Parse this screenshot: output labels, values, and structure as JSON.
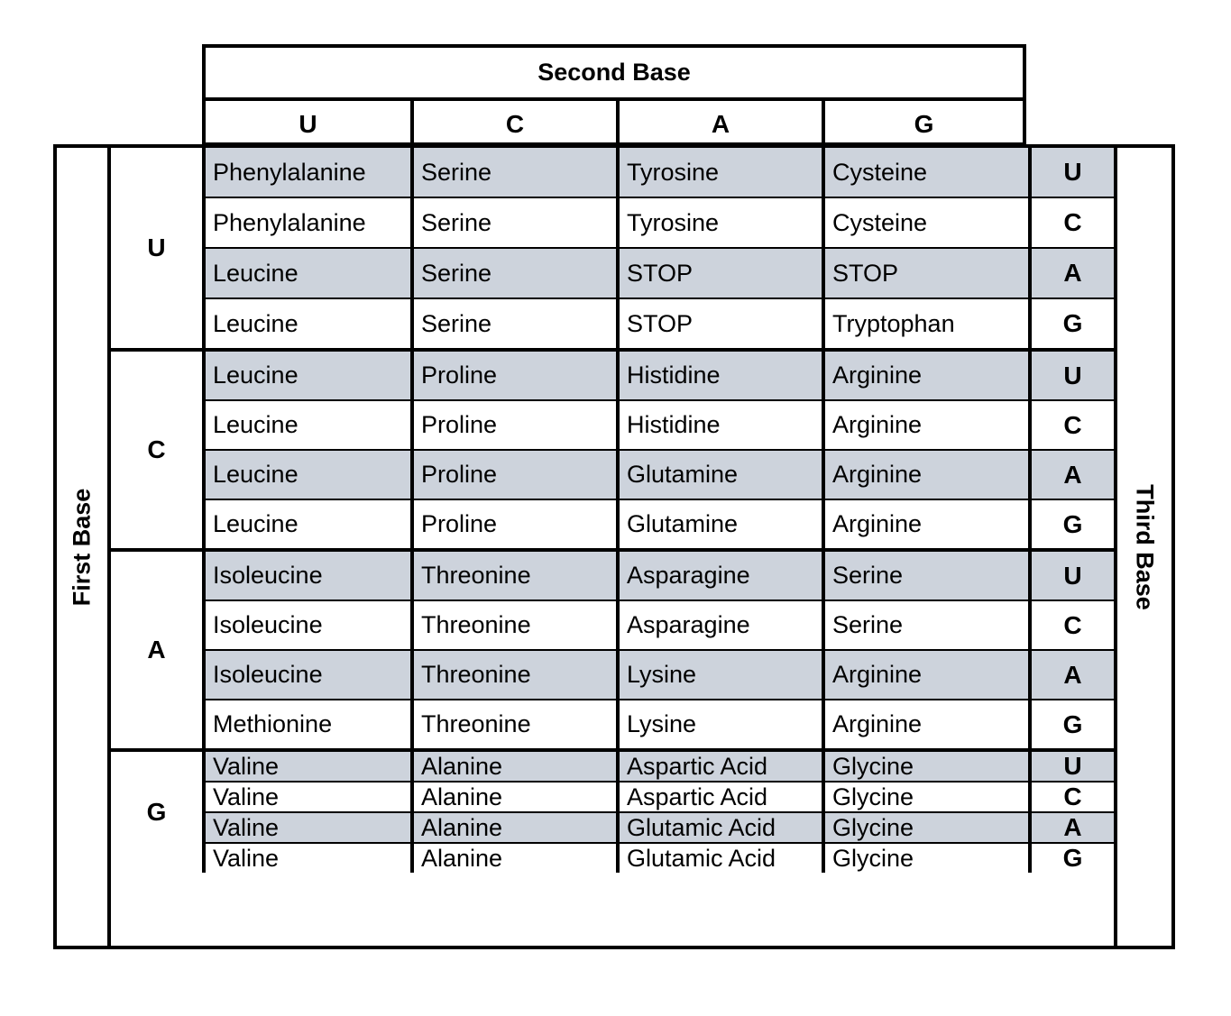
{
  "second_base": {
    "title": "Second Base",
    "columns": [
      "U",
      "C",
      "A",
      "G"
    ]
  },
  "first_base": {
    "title": "First Base"
  },
  "third_base": {
    "title": "Third Base"
  },
  "colors": {
    "shaded_row": "#cdd3dc",
    "border": "#000000"
  },
  "groups": [
    {
      "first": "U",
      "rows": [
        {
          "cells": [
            "Phenylalanine",
            "Serine",
            "Tyrosine",
            "Cysteine"
          ],
          "third": "U"
        },
        {
          "cells": [
            "Phenylalanine",
            "Serine",
            "Tyrosine",
            "Cysteine"
          ],
          "third": "C"
        },
        {
          "cells": [
            "Leucine",
            "Serine",
            "STOP",
            "STOP"
          ],
          "third": "A"
        },
        {
          "cells": [
            "Leucine",
            "Serine",
            "STOP",
            "Tryptophan"
          ],
          "third": "G"
        }
      ]
    },
    {
      "first": "C",
      "rows": [
        {
          "cells": [
            "Leucine",
            "Proline",
            "Histidine",
            "Arginine"
          ],
          "third": "U"
        },
        {
          "cells": [
            "Leucine",
            "Proline",
            "Histidine",
            "Arginine"
          ],
          "third": "C"
        },
        {
          "cells": [
            "Leucine",
            "Proline",
            "Glutamine",
            "Arginine"
          ],
          "third": "A"
        },
        {
          "cells": [
            "Leucine",
            "Proline",
            "Glutamine",
            "Arginine"
          ],
          "third": "G"
        }
      ]
    },
    {
      "first": "A",
      "rows": [
        {
          "cells": [
            "Isoleucine",
            "Threonine",
            "Asparagine",
            "Serine"
          ],
          "third": "U"
        },
        {
          "cells": [
            "Isoleucine",
            "Threonine",
            "Asparagine",
            "Serine"
          ],
          "third": "C"
        },
        {
          "cells": [
            "Isoleucine",
            "Threonine",
            "Lysine",
            "Arginine"
          ],
          "third": "A"
        },
        {
          "cells": [
            "Methionine",
            "Threonine",
            "Lysine",
            "Arginine"
          ],
          "third": "G"
        }
      ]
    },
    {
      "first": "G",
      "rows": [
        {
          "cells": [
            "Valine",
            "Alanine",
            "Aspartic Acid",
            "Glycine"
          ],
          "third": "U"
        },
        {
          "cells": [
            "Valine",
            "Alanine",
            "Aspartic Acid",
            "Glycine"
          ],
          "third": "C"
        },
        {
          "cells": [
            "Valine",
            "Alanine",
            "Glutamic Acid",
            "Glycine"
          ],
          "third": "A"
        },
        {
          "cells": [
            "Valine",
            "Alanine",
            "Glutamic Acid",
            "Glycine"
          ],
          "third": "G"
        }
      ]
    }
  ]
}
